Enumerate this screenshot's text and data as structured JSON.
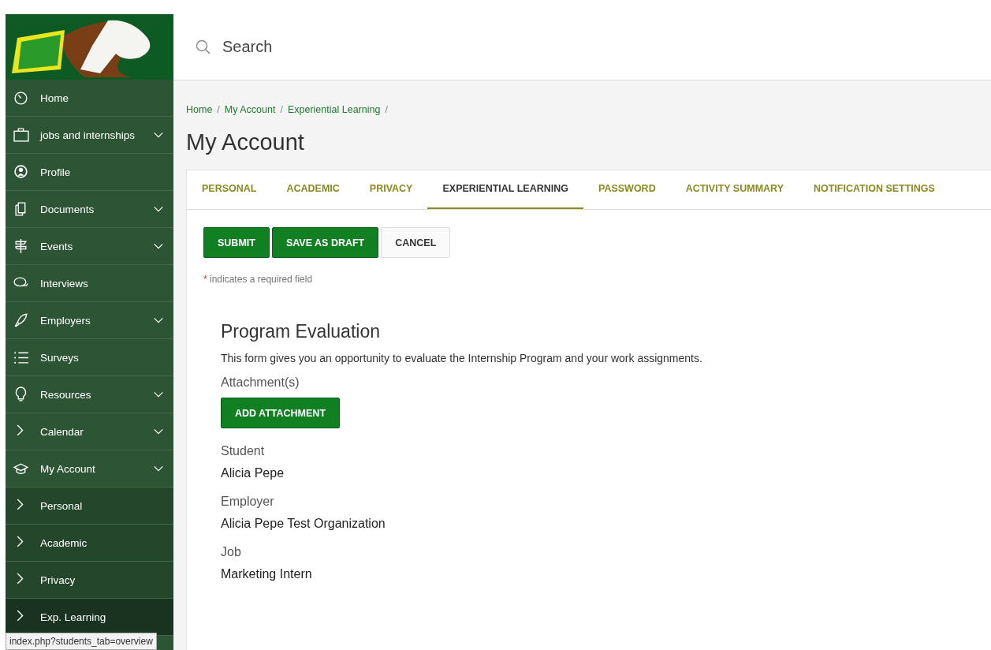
{
  "header": {
    "search": {
      "placeholder": "Search"
    }
  },
  "sidebar": {
    "items": [
      {
        "label": "Home",
        "expandable": false,
        "selected": false
      },
      {
        "label": "jobs and internships",
        "expandable": true,
        "selected": false
      },
      {
        "label": "Profile",
        "expandable": false,
        "selected": false
      },
      {
        "label": "Documents",
        "expandable": true,
        "selected": false
      },
      {
        "label": "Events",
        "expandable": true,
        "selected": false
      },
      {
        "label": "Interviews",
        "expandable": false,
        "selected": false
      },
      {
        "label": "Employers",
        "expandable": true,
        "selected": false
      },
      {
        "label": "Surveys",
        "expandable": false,
        "selected": false
      },
      {
        "label": "Resources",
        "expandable": true,
        "selected": false
      },
      {
        "label": "Calendar",
        "expandable": true,
        "selected": false
      },
      {
        "label": "My Account",
        "expandable": true,
        "selected": false,
        "children": [
          {
            "label": "Personal",
            "selected": false
          },
          {
            "label": "Academic",
            "selected": false
          },
          {
            "label": "Privacy",
            "selected": false
          },
          {
            "label": "Exp. Learning",
            "selected": true
          }
        ]
      }
    ]
  },
  "status_bar": {
    "url": "index.php?students_tab=overview"
  },
  "breadcrumb": [
    {
      "label": "Home",
      "separator": "/"
    },
    {
      "label": "My Account",
      "separator": "/"
    },
    {
      "label": "Experiential Learning",
      "separator": "/"
    }
  ],
  "page_title": "My Account",
  "tabs": [
    {
      "label": "PERSONAL",
      "selected": false
    },
    {
      "label": "ACADEMIC",
      "selected": false
    },
    {
      "label": "PRIVACY",
      "selected": false
    },
    {
      "label": "EXPERIENTIAL LEARNING",
      "selected": true
    },
    {
      "label": "PASSWORD",
      "selected": false
    },
    {
      "label": "ACTIVITY SUMMARY",
      "selected": false
    },
    {
      "label": "NOTIFICATION SETTINGS",
      "selected": false
    }
  ],
  "actions": [
    {
      "label": "SUBMIT",
      "kind": "primary"
    },
    {
      "label": "SAVE AS DRAFT",
      "kind": "primary"
    },
    {
      "label": "CANCEL",
      "kind": "secondary"
    }
  ],
  "required_note": {
    "mark": "*",
    "text": "indicates a required field"
  },
  "form": {
    "title": "Program Evaluation",
    "description": "This form gives you an opportunity to evaluate the Internship Program and your work assignments.",
    "attachments": {
      "label": "Attachment(s)",
      "button": "ADD ATTACHMENT"
    },
    "fields": [
      {
        "label": "Student",
        "value": "Alicia Pepe"
      },
      {
        "label": "Employer",
        "value": "Alicia Pepe Test Organization"
      },
      {
        "label": "Job",
        "value": "Marketing Intern"
      }
    ]
  }
}
